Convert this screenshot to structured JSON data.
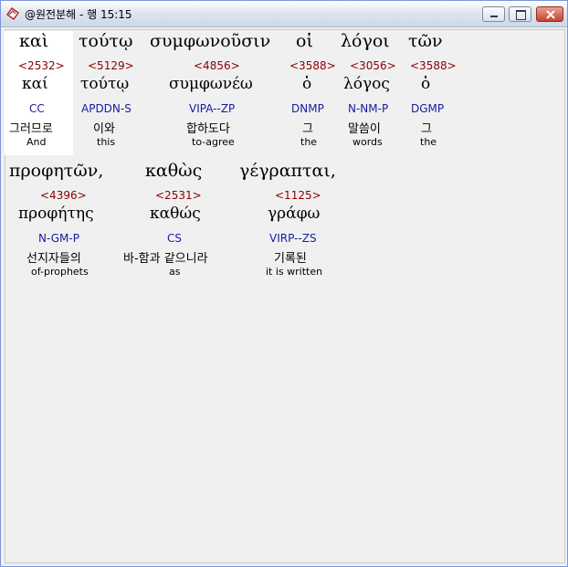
{
  "window": {
    "title": "@원전분해 - 행 15:15",
    "icon": "app-icon"
  },
  "words": [
    {
      "greek": "καὶ",
      "strong": "<2532>",
      "lemma": "καί",
      "parsing": "CC",
      "korean": "그러므로",
      "english": "And"
    },
    {
      "greek": "τούτῳ",
      "strong": "<5129>",
      "lemma": "τούτῳ",
      "parsing": "APDDN-S",
      "korean": "이와",
      "english": "this"
    },
    {
      "greek": "συμφωνοῦσιν",
      "strong": "<4856>",
      "lemma": "συμφωνέω",
      "parsing": "VIPA--ZP",
      "korean": "합하도다",
      "english": "to-agree"
    },
    {
      "greek": "οἱ",
      "strong": "<3588>",
      "lemma": "ὁ",
      "parsing": "DNMP",
      "korean": "그",
      "english": "the"
    },
    {
      "greek": "λόγοι",
      "strong": "<3056>",
      "lemma": "λόγος",
      "parsing": "N-NM-P",
      "korean": "말씀이",
      "english": "words"
    },
    {
      "greek": "τῶν",
      "strong": "<3588>",
      "lemma": "ὁ",
      "parsing": "DGMP",
      "korean": "그",
      "english": "the"
    },
    {
      "greek": "προφητῶν,",
      "strong": "<4396>",
      "lemma": "προφήτης",
      "parsing": "N-GM-P",
      "korean": "선지자들의",
      "english": "of-prophets"
    },
    {
      "greek": "καθὼς",
      "strong": "<2531>",
      "lemma": "καθώς",
      "parsing": "CS",
      "korean": "바-함과 같으니라",
      "english": "as"
    },
    {
      "greek": "γέγραπται,",
      "strong": "<1125>",
      "lemma": "γράφω",
      "parsing": "VIRP--ZS",
      "korean": "기록된",
      "english": "it is written"
    }
  ]
}
